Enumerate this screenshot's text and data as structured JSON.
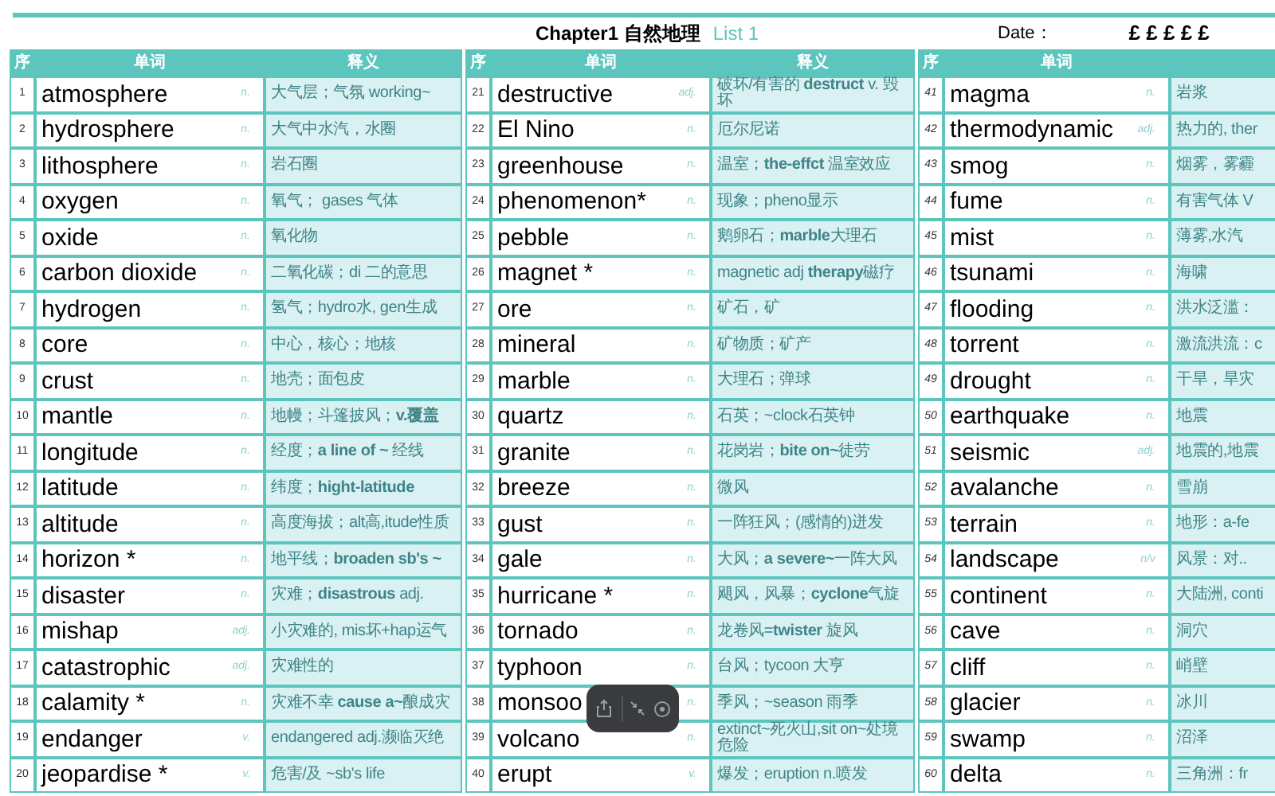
{
  "title": {
    "chapter": "Chapter1 自然地理",
    "list": "List 1"
  },
  "date": {
    "label": "Date：",
    "value": "£ £ £ £ £"
  },
  "groups": [
    {
      "headers": [
        "序",
        "单词",
        "释义"
      ],
      "rows": [
        {
          "index": "1",
          "word": "atmosphere",
          "pos": "n.",
          "meaning": "大气层；气氛 working~"
        },
        {
          "index": "2",
          "word": "hydrosphere",
          "pos": "n.",
          "meaning": "大气中水汽，水圈"
        },
        {
          "index": "3",
          "word": "lithosphere",
          "pos": "n.",
          "meaning": "岩石圈"
        },
        {
          "index": "4",
          "word": "oxygen",
          "pos": "n.",
          "meaning": "氧气； gases 气体"
        },
        {
          "index": "5",
          "word": "oxide",
          "pos": "n.",
          "meaning": "氧化物"
        },
        {
          "index": "6",
          "word": "carbon dioxide",
          "pos": "n.",
          "meaning": "二氧化碳；di 二的意思"
        },
        {
          "index": "7",
          "word": "hydrogen",
          "pos": "n.",
          "meaning": "氢气；hydro水, gen生成"
        },
        {
          "index": "8",
          "word": "core",
          "pos": "n.",
          "meaning": "中心，核心；地核"
        },
        {
          "index": "9",
          "word": "crust",
          "pos": "n.",
          "meaning": "地壳；面包皮"
        },
        {
          "index": "10",
          "word": "mantle",
          "pos": "n.",
          "meaning": "地幔；斗篷披风；**v.覆盖**"
        },
        {
          "index": "11",
          "word": "longitude",
          "pos": "n.",
          "meaning": "经度；**a line of ~** 经线"
        },
        {
          "index": "12",
          "word": "latitude",
          "pos": "n.",
          "meaning": "纬度；**hight-latitude**"
        },
        {
          "index": "13",
          "word": "altitude",
          "pos": "n.",
          "meaning": "高度海拔；alt高,itude性质"
        },
        {
          "index": "14",
          "word": "horizon *",
          "pos": "n.",
          "meaning": "地平线；**broaden sb's ~**"
        },
        {
          "index": "15",
          "word": "disaster",
          "pos": "n.",
          "meaning": "灾难；**disastrous** adj."
        },
        {
          "index": "16",
          "word": "mishap",
          "pos": "adj.",
          "meaning": "小灾难的, mis坏+hap运气"
        },
        {
          "index": "17",
          "word": "catastrophic",
          "pos": "adj.",
          "meaning": "灾难性的"
        },
        {
          "index": "18",
          "word": "calamity *",
          "pos": "n.",
          "meaning": "灾难不幸 **cause a~**酿成灾"
        },
        {
          "index": "19",
          "word": "endanger",
          "pos": "v.",
          "meaning": "endangered adj.濒临灭绝"
        },
        {
          "index": "20",
          "word": "jeopardise *",
          "pos": "v.",
          "meaning": "危害/及 ~sb's life"
        }
      ]
    },
    {
      "headers": [
        "序",
        "单词",
        "释义"
      ],
      "rows": [
        {
          "index": "21",
          "word": "destructive",
          "pos": "adj.",
          "meaning": "破坏/有害的 **destruct** v. 毁坏"
        },
        {
          "index": "22",
          "word": "El Nino",
          "pos": "n.",
          "meaning": "厄尔尼诺"
        },
        {
          "index": "23",
          "word": "greenhouse",
          "pos": "n.",
          "meaning": "温室；**the-effct** 温室效应"
        },
        {
          "index": "24",
          "word": "phenomenon*",
          "pos": "n.",
          "meaning": "现象；pheno显示"
        },
        {
          "index": "25",
          "word": "pebble",
          "pos": "n.",
          "meaning": "鹅卵石；**marble**大理石"
        },
        {
          "index": "26",
          "word": "magnet *",
          "pos": "n.",
          "meaning": "magnetic adj **therapy**磁疗"
        },
        {
          "index": "27",
          "word": "ore",
          "pos": "n.",
          "meaning": "矿石，矿"
        },
        {
          "index": "28",
          "word": "mineral",
          "pos": "n.",
          "meaning": "矿物质；矿产"
        },
        {
          "index": "29",
          "word": "marble",
          "pos": "n.",
          "meaning": "大理石；弹球"
        },
        {
          "index": "30",
          "word": "quartz",
          "pos": "n.",
          "meaning": "石英；~clock石英钟"
        },
        {
          "index": "31",
          "word": "granite",
          "pos": "n.",
          "meaning": "花岗岩；**bite on~**徒劳"
        },
        {
          "index": "32",
          "word": "breeze",
          "pos": "n.",
          "meaning": "微风"
        },
        {
          "index": "33",
          "word": "gust",
          "pos": "n.",
          "meaning": "一阵狂风；(感情的)迸发"
        },
        {
          "index": "34",
          "word": "gale",
          "pos": "n.",
          "meaning": "大风；**a severe~**一阵大风"
        },
        {
          "index": "35",
          "word": "hurricane *",
          "pos": "n.",
          "meaning": "飓风，风暴；**cyclone**气旋"
        },
        {
          "index": "36",
          "word": "tornado",
          "pos": "n.",
          "meaning": "龙卷风=**twister** 旋风"
        },
        {
          "index": "37",
          "word": "typhoon",
          "pos": "n.",
          "meaning": "台风；tycoon 大亨"
        },
        {
          "index": "38",
          "word": "monsoo",
          "pos": "n.",
          "meaning": "季风；~season 雨季"
        },
        {
          "index": "39",
          "word": "volcano",
          "pos": "n.",
          "meaning": "extinct~死火山,sit on~处境危险"
        },
        {
          "index": "40",
          "word": "erupt",
          "pos": "v.",
          "meaning": "爆发；eruption n.喷发"
        }
      ]
    },
    {
      "headers": [
        "序",
        "单词"
      ],
      "rows": [
        {
          "index": "41",
          "word": "magma",
          "pos": "n.",
          "meaning": "岩浆"
        },
        {
          "index": "42",
          "word": "thermodynamic",
          "pos": "adj.",
          "meaning": "热力的, ther"
        },
        {
          "index": "43",
          "word": "smog",
          "pos": "n.",
          "meaning": "烟雾，雾霾"
        },
        {
          "index": "44",
          "word": "fume",
          "pos": "n.",
          "meaning": "有害气体 V"
        },
        {
          "index": "45",
          "word": "mist",
          "pos": "n.",
          "meaning": "薄雾,水汽"
        },
        {
          "index": "46",
          "word": "tsunami",
          "pos": "n.",
          "meaning": "海啸"
        },
        {
          "index": "47",
          "word": "flooding",
          "pos": "n.",
          "meaning": "洪水泛滥："
        },
        {
          "index": "48",
          "word": "torrent",
          "pos": "n.",
          "meaning": "激流洪流：c"
        },
        {
          "index": "49",
          "word": "drought",
          "pos": "n.",
          "meaning": "干旱，旱灾"
        },
        {
          "index": "50",
          "word": "earthquake",
          "pos": "n.",
          "meaning": "地震"
        },
        {
          "index": "51",
          "word": "seismic",
          "pos": "adj.",
          "meaning": "地震的,地震"
        },
        {
          "index": "52",
          "word": "avalanche",
          "pos": "n.",
          "meaning": "雪崩"
        },
        {
          "index": "53",
          "word": "terrain",
          "pos": "n.",
          "meaning": "地形：a-fe"
        },
        {
          "index": "54",
          "word": "landscape",
          "pos": "n/v",
          "meaning": "风景：对.."
        },
        {
          "index": "55",
          "word": "continent",
          "pos": "n.",
          "meaning": "大陆洲, conti"
        },
        {
          "index": "56",
          "word": "cave",
          "pos": "n.",
          "meaning": "洞穴"
        },
        {
          "index": "57",
          "word": "cliff",
          "pos": "n.",
          "meaning": "峭壁"
        },
        {
          "index": "58",
          "word": "glacier",
          "pos": "n.",
          "meaning": "冰川"
        },
        {
          "index": "59",
          "word": "swamp",
          "pos": "n.",
          "meaning": "沼泽"
        },
        {
          "index": "60",
          "word": "delta",
          "pos": "n.",
          "meaning": "三角洲：fr"
        }
      ]
    }
  ]
}
